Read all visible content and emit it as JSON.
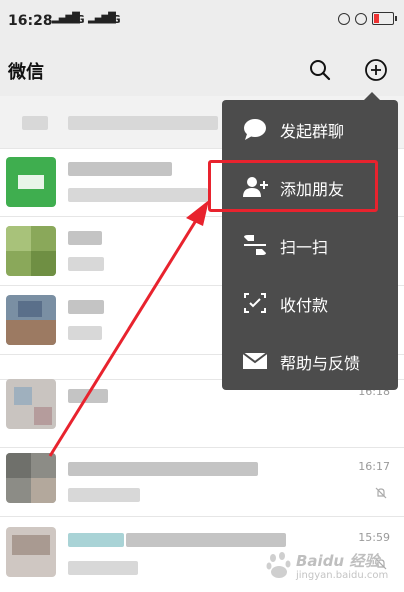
{
  "status_bar": {
    "time": "16:28",
    "signal1": "5G",
    "signal2": "4G"
  },
  "header": {
    "title": "微信"
  },
  "menu": {
    "items": [
      {
        "label": "发起群聊",
        "icon": "chat-bubble-icon"
      },
      {
        "label": "添加朋友",
        "icon": "add-contact-icon"
      },
      {
        "label": "扫一扫",
        "icon": "scan-icon"
      },
      {
        "label": "收付款",
        "icon": "payment-icon"
      },
      {
        "label": "帮助与反馈",
        "icon": "mail-icon"
      }
    ]
  },
  "chats": [
    {
      "time": ""
    },
    {
      "time": ""
    },
    {
      "time": ""
    },
    {
      "time": ""
    },
    {
      "time": "16:18"
    },
    {
      "time": "16:17"
    },
    {
      "time": "15:59"
    }
  ],
  "watermark": {
    "brand": "Baidu 经验",
    "url": "jingyan.baidu.com"
  },
  "colors": {
    "highlight": "#e8232e",
    "menu_bg": "#4c4c4c",
    "header_bg": "#ededed"
  }
}
